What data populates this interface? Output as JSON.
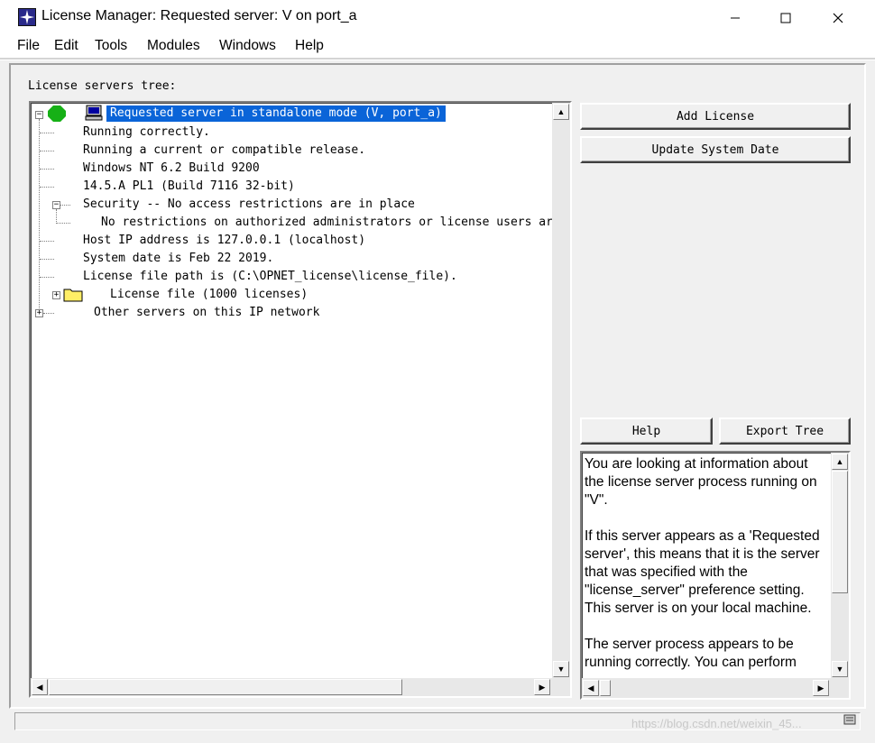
{
  "window": {
    "title": "License Manager: Requested server: V on port_a",
    "minimize": "—",
    "maximize": "☐",
    "close": "✕"
  },
  "menu": [
    "File",
    "Edit",
    "Tools",
    "Modules",
    "Windows",
    "Help"
  ],
  "tree_label": "License servers tree:",
  "tree": {
    "root": "Requested server in standalone mode (V, port_a)",
    "running": "Running correctly.",
    "release": "Running a current or compatible release.",
    "os": "Windows NT 6.2 Build 9200",
    "version": "14.5.A PL1 (Build 7116 32-bit)",
    "security": "Security -- No access restrictions are in place",
    "security_child": "No restrictions on authorized administrators or license users are i",
    "host_ip": "Host IP address is 127.0.0.1 (localhost)",
    "system_date": "System date is Feb 22 2019.",
    "license_path": "License file path is (C:\\OPNET_license\\license_file).",
    "license_file": "License file (1000 licenses)",
    "other_servers": "Other servers on this IP network"
  },
  "buttons": {
    "add_license": "Add License",
    "update_system_date": "Update System Date",
    "help": "Help",
    "export_tree": "Export Tree"
  },
  "info": {
    "p1": "You are looking at information about the license server process running on \"V\".",
    "p2": "If this server appears as a 'Requested server', this means that it is the server that was specified with the \"license_server\" preference setting.",
    "p3": "This server is on your local machine.",
    "p4": "The server process appears to be running correctly.  You can perform"
  },
  "watermark": "https://blog.csdn.net/weixin_45..."
}
